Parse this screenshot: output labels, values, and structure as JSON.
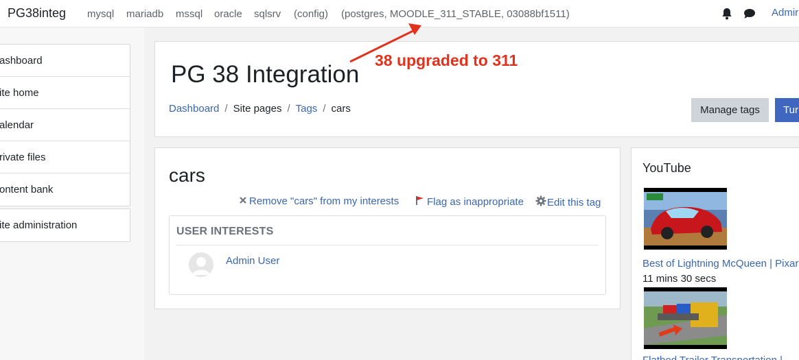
{
  "topbar": {
    "brand": "PG38integ",
    "links": [
      {
        "label": "mysql"
      },
      {
        "label": "mariadb"
      },
      {
        "label": "mssql"
      },
      {
        "label": "oracle"
      },
      {
        "label": "sqlsrv"
      },
      {
        "label": "(config)"
      },
      {
        "label": "(postgres, MOODLE_311_STABLE, 03088bf1511)"
      }
    ],
    "icons": [
      "bell-icon",
      "chat-icon"
    ],
    "user_label": "Admir"
  },
  "sidebar": {
    "items": [
      {
        "label": "ashboard"
      },
      {
        "label": "ite home"
      },
      {
        "label": "alendar"
      },
      {
        "label": "rivate files"
      },
      {
        "label": "ontent bank"
      }
    ],
    "admin": {
      "label": "ite administration"
    }
  },
  "header": {
    "title": "PG 38 Integration",
    "breadcrumb": [
      {
        "label": "Dashboard"
      },
      {
        "label": "Site pages"
      },
      {
        "label": "Tags"
      },
      {
        "label": "cars"
      }
    ],
    "separator": "/",
    "buttons": {
      "manage": "Manage tags",
      "turn": "Tur"
    }
  },
  "tag": {
    "name": "cars",
    "actions": {
      "remove": "Remove \"cars\" from my interests",
      "flag": "Flag as inappropriate",
      "edit": "Edit this tag"
    },
    "user_interests": {
      "heading": "USER INTERESTS",
      "users": [
        {
          "name": "Admin User"
        }
      ]
    }
  },
  "youtube": {
    "title": "YouTube",
    "videos": [
      {
        "title": "Best of Lightning McQueen | Pixar",
        "duration": "11 mins 30 secs"
      },
      {
        "title": "Flatbed Trailer Transportation |",
        "duration": ""
      }
    ]
  },
  "annotation": {
    "text": "38 upgraded to 311",
    "color": "#e0321c"
  },
  "colors": {
    "link": "#3a66b0",
    "primary_button": "#3f67c0",
    "secondary_button": "#ced4da"
  }
}
